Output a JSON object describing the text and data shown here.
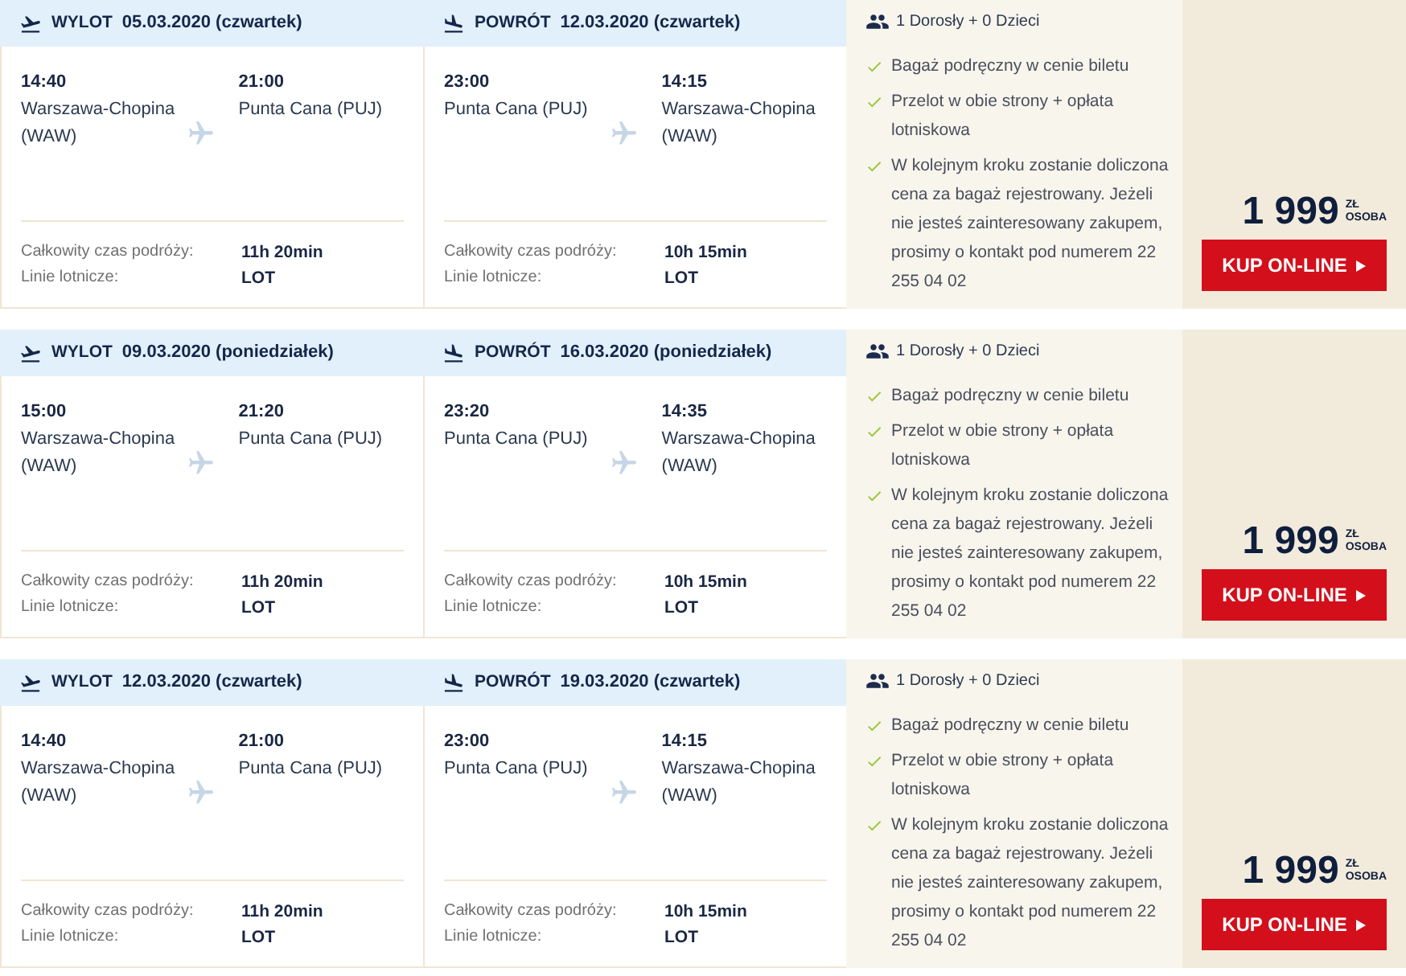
{
  "offers": [
    {
      "legs": [
        {
          "kind": "departure",
          "label": "WYLOT",
          "date": "05.03.2020 (czwartek)",
          "from_time": "14:40",
          "from_place": "Warszawa-Chopina (WAW)",
          "to_time": "21:00",
          "to_place": "Punta Cana (PUJ)",
          "duration_label": "Całkowity czas podróży:",
          "duration": "11h 20min",
          "airline_label": "Linie lotnicze:",
          "airline": "LOT"
        },
        {
          "kind": "return",
          "label": "POWRÓT",
          "date": "12.03.2020 (czwartek)",
          "from_time": "23:00",
          "from_place": "Punta Cana (PUJ)",
          "to_time": "14:15",
          "to_place": "Warszawa-Chopina (WAW)",
          "duration_label": "Całkowity czas podróży:",
          "duration": "10h 15min",
          "airline_label": "Linie lotnicze:",
          "airline": "LOT"
        }
      ],
      "passengers": "1 Dorosły + 0 Dzieci",
      "features": [
        "Bagaż podręczny w cenie biletu",
        "Przelot w obie strony + opłata lotniskowa",
        "W kolejnym kroku zostanie doliczona cena za bagaż rejestrowany. Jeżeli nie jesteś zainteresowany zakupem, prosimy o kontakt pod numerem 22 255 04 02"
      ],
      "price": "1 999",
      "currency": "ZŁ",
      "per": "OSOBA",
      "button": "KUP ON-LINE"
    },
    {
      "legs": [
        {
          "kind": "departure",
          "label": "WYLOT",
          "date": "09.03.2020 (poniedziałek)",
          "from_time": "15:00",
          "from_place": "Warszawa-Chopina (WAW)",
          "to_time": "21:20",
          "to_place": "Punta Cana (PUJ)",
          "duration_label": "Całkowity czas podróży:",
          "duration": "11h 20min",
          "airline_label": "Linie lotnicze:",
          "airline": "LOT"
        },
        {
          "kind": "return",
          "label": "POWRÓT",
          "date": "16.03.2020 (poniedziałek)",
          "from_time": "23:20",
          "from_place": "Punta Cana (PUJ)",
          "to_time": "14:35",
          "to_place": "Warszawa-Chopina (WAW)",
          "duration_label": "Całkowity czas podróży:",
          "duration": "10h 15min",
          "airline_label": "Linie lotnicze:",
          "airline": "LOT"
        }
      ],
      "passengers": "1 Dorosły + 0 Dzieci",
      "features": [
        "Bagaż podręczny w cenie biletu",
        "Przelot w obie strony + opłata lotniskowa",
        "W kolejnym kroku zostanie doliczona cena za bagaż rejestrowany. Jeżeli nie jesteś zainteresowany zakupem, prosimy o kontakt pod numerem 22 255 04 02"
      ],
      "price": "1 999",
      "currency": "ZŁ",
      "per": "OSOBA",
      "button": "KUP ON-LINE"
    },
    {
      "legs": [
        {
          "kind": "departure",
          "label": "WYLOT",
          "date": "12.03.2020 (czwartek)",
          "from_time": "14:40",
          "from_place": "Warszawa-Chopina (WAW)",
          "to_time": "21:00",
          "to_place": "Punta Cana (PUJ)",
          "duration_label": "Całkowity czas podróży:",
          "duration": "11h 20min",
          "airline_label": "Linie lotnicze:",
          "airline": "LOT"
        },
        {
          "kind": "return",
          "label": "POWRÓT",
          "date": "19.03.2020 (czwartek)",
          "from_time": "23:00",
          "from_place": "Punta Cana (PUJ)",
          "to_time": "14:15",
          "to_place": "Warszawa-Chopina (WAW)",
          "duration_label": "Całkowity czas podróży:",
          "duration": "10h 15min",
          "airline_label": "Linie lotnicze:",
          "airline": "LOT"
        }
      ],
      "passengers": "1 Dorosły + 0 Dzieci",
      "features": [
        "Bagaż podręczny w cenie biletu",
        "Przelot w obie strony + opłata lotniskowa",
        "W kolejnym kroku zostanie doliczona cena za bagaż rejestrowany. Jeżeli nie jesteś zainteresowany zakupem, prosimy o kontakt pod numerem 22 255 04 02"
      ],
      "price": "1 999",
      "currency": "ZŁ",
      "per": "OSOBA",
      "button": "KUP ON-LINE"
    }
  ]
}
